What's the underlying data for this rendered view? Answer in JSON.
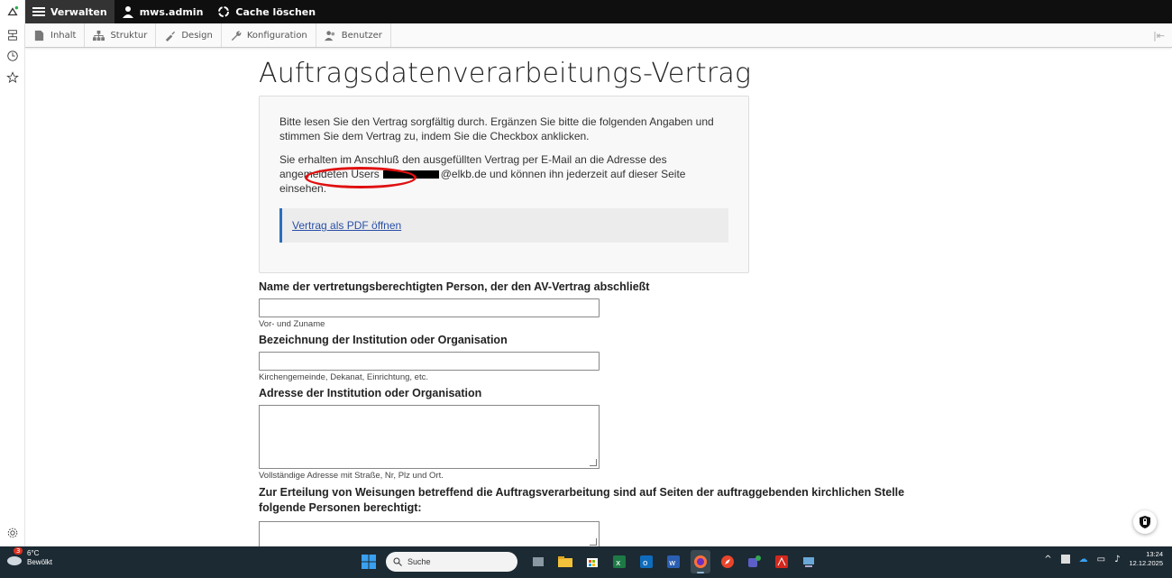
{
  "toolbar": {
    "manage_label": "Verwalten",
    "user_label": "mws.admin",
    "cache_label": "Cache löschen"
  },
  "tray": {
    "items": [
      {
        "label": "Inhalt",
        "icon": "file-icon"
      },
      {
        "label": "Struktur",
        "icon": "sitemap-icon"
      },
      {
        "label": "Design",
        "icon": "brush-icon"
      },
      {
        "label": "Konfiguration",
        "icon": "wrench-icon"
      },
      {
        "label": "Benutzer",
        "icon": "users-icon"
      }
    ]
  },
  "page": {
    "title": "Auftragsdatenverarbeitungs-Vertrag",
    "intro_p1": "Bitte lesen Sie den Vertrag sorgfältig durch. Ergänzen Sie bitte die folgenden Angaben und stimmen Sie dem Vertrag zu, indem Sie die Checkbox anklicken.",
    "intro_p2_a": "Sie erhalten im Anschluß den ausgefüllten Vertrag per E-Mail an die Adresse des angemeldeten Users",
    "intro_p2_email_suffix": "@elkb.de",
    "intro_p2_b": "und können ihn jederzeit auf dieser Seite einsehen.",
    "pdf_link": "Vertrag als PDF öffnen"
  },
  "form": {
    "name_label": "Name der vertretungsberechtigten Person, der den AV-Vertrag abschließt",
    "name_desc": "Vor- und Zuname",
    "org_label": "Bezeichnung der Institution oder Organisation",
    "org_desc": "Kirchengemeinde, Dekanat, Einrichtung, etc.",
    "address_label": "Adresse der Institution oder Organisation",
    "address_desc": "Vollständige Adresse mit Straße, Nr, Plz und Ort.",
    "persons_label": "Zur Erteilung von Weisungen betreffend die Auftragsverarbeitung sind auf Seiten der auftraggebenden kirchlichen Stelle folgende Personen berechtigt:"
  },
  "taskbar": {
    "weather_temp": "6°C",
    "weather_desc": "Bewölkt",
    "weather_badge": "3",
    "search_placeholder": "Suche",
    "time": "13:24",
    "date": "12.12.2025"
  }
}
